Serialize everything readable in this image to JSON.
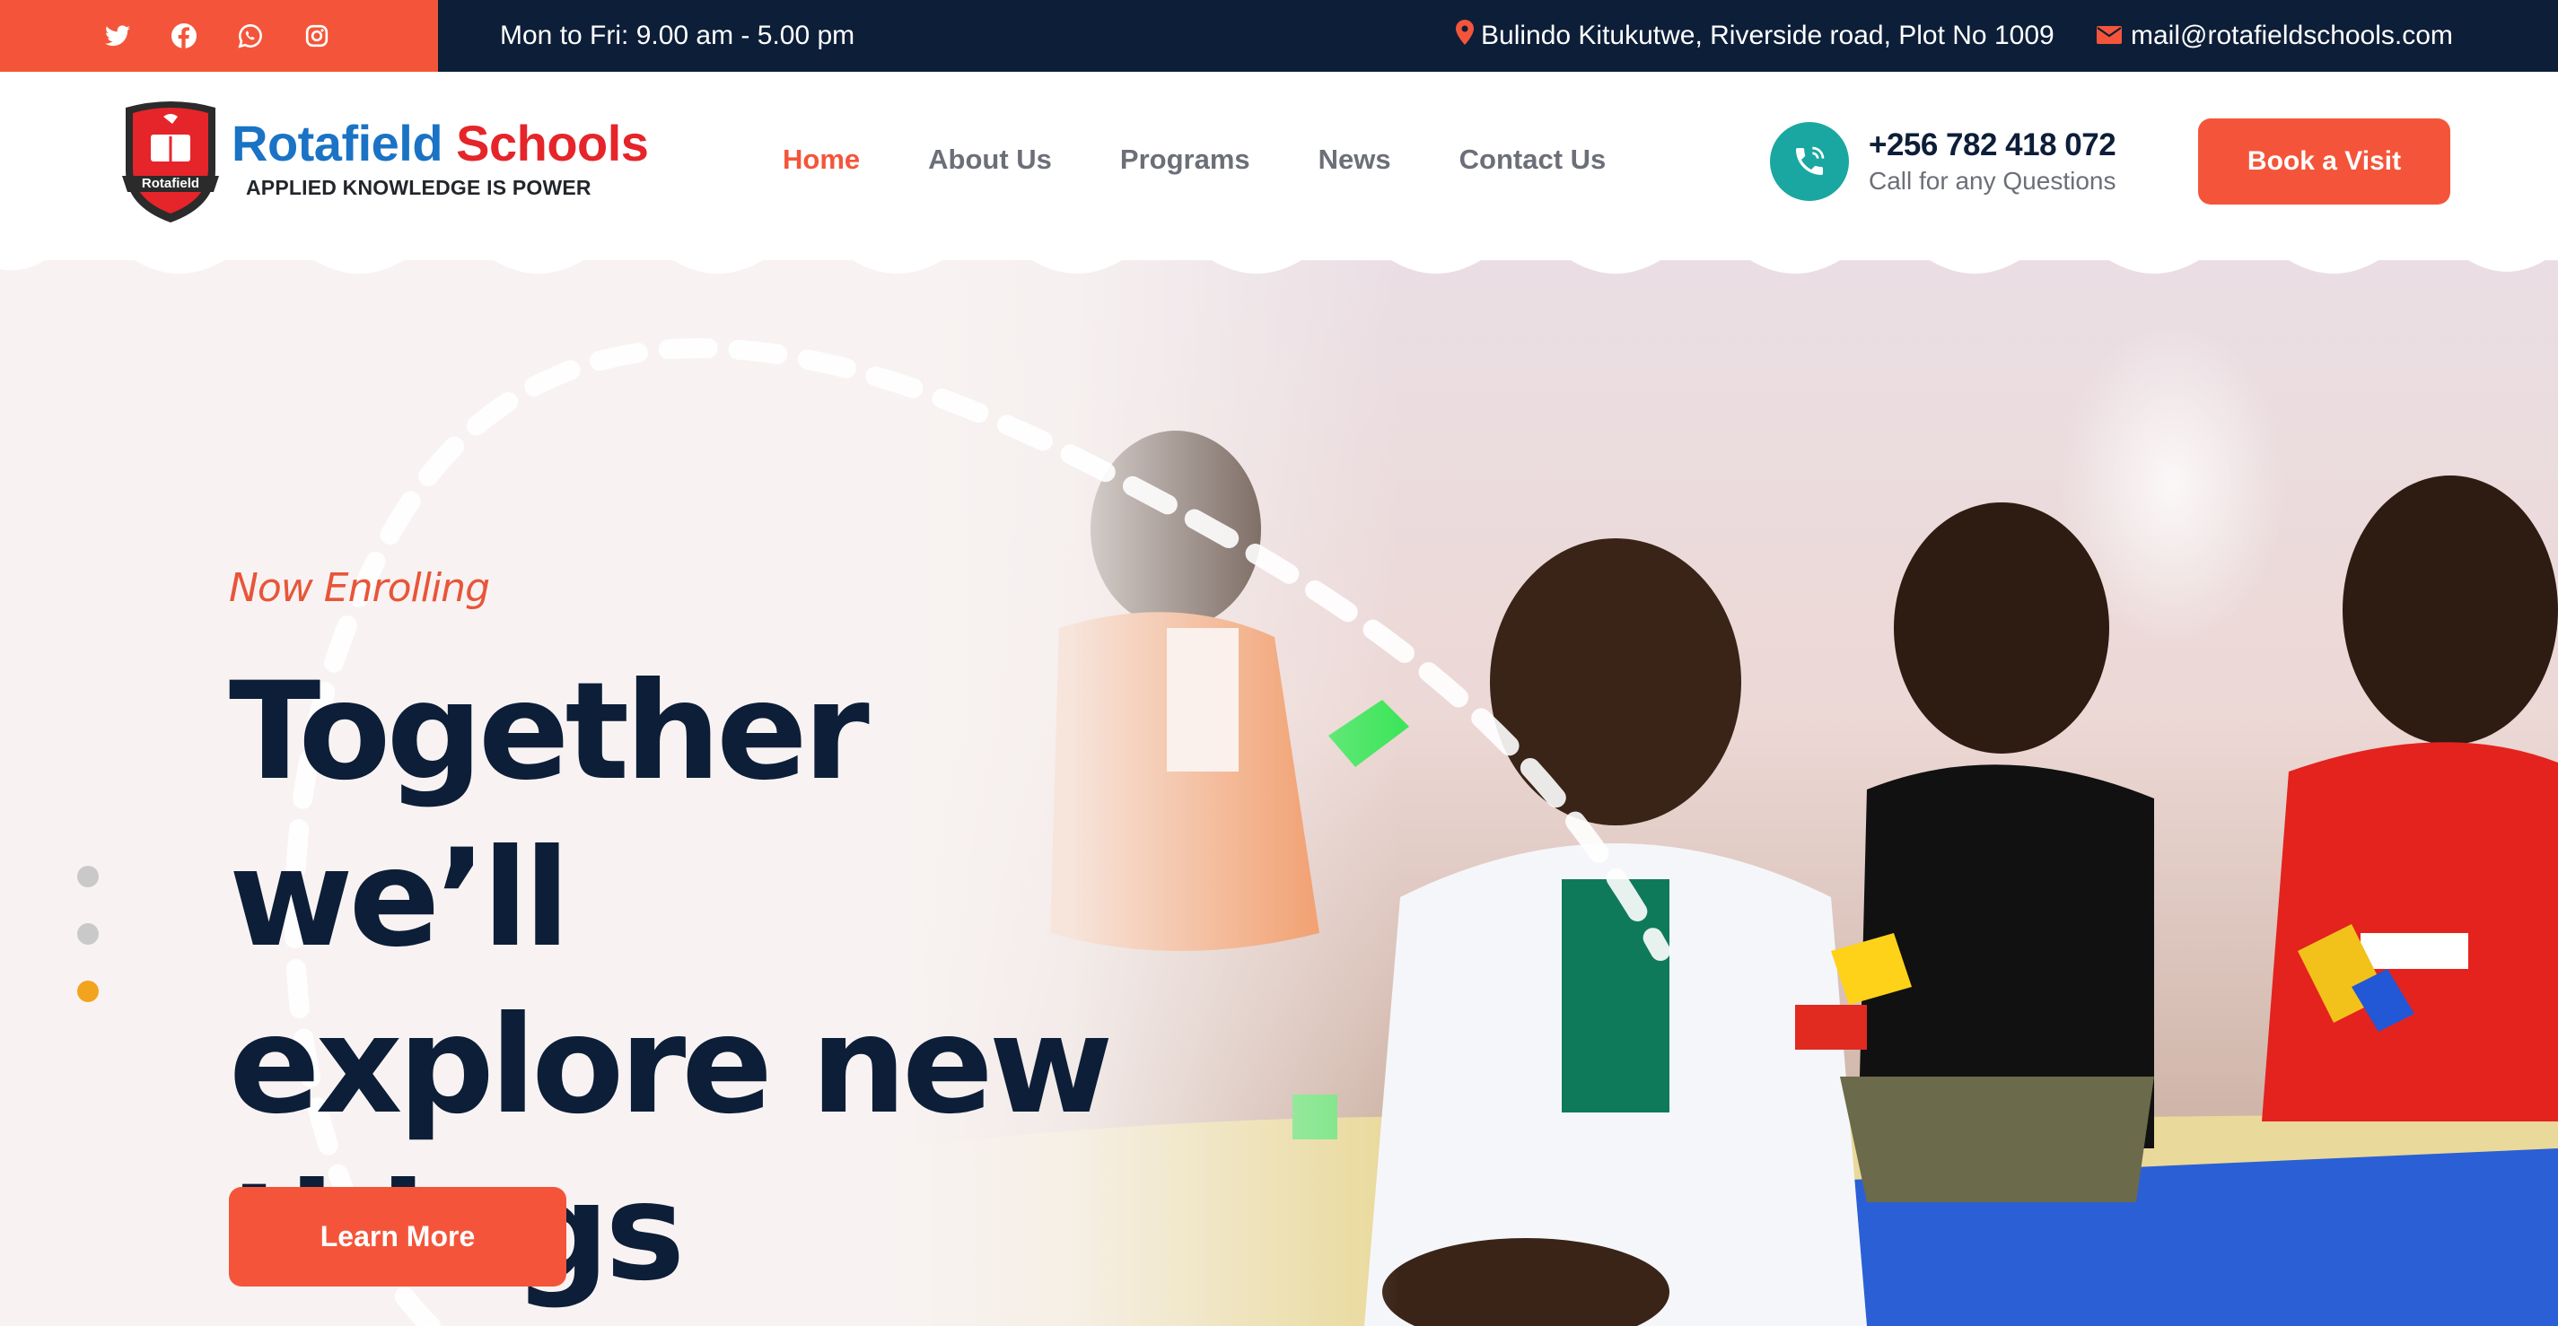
{
  "topbar": {
    "social_icons": [
      "twitter-icon",
      "facebook-icon",
      "whatsapp-icon",
      "instagram-icon"
    ],
    "hours": "Mon to Fri: 9.00 am - 5.00 pm",
    "address": "Bulindo Kitukutwe, Riverside road, Plot No 1009",
    "email": "mail@rotafieldschools.com"
  },
  "header": {
    "logo": {
      "name_part1": "Rotafield",
      "name_part2": "Schools",
      "tagline": "APPLIED KNOWLEDGE IS POWER",
      "crest_text": "Rotafield"
    },
    "nav": [
      {
        "label": "Home",
        "active": true
      },
      {
        "label": "About Us",
        "active": false
      },
      {
        "label": "Programs",
        "active": false
      },
      {
        "label": "News",
        "active": false
      },
      {
        "label": "Contact Us",
        "active": false
      }
    ],
    "phone": {
      "number": "+256 782 418 072",
      "caption": "Call for any Questions"
    },
    "cta_label": "Book a Visit"
  },
  "hero": {
    "eyebrow": "Now Enrolling",
    "headline_line1": "Together we’ll",
    "headline_line2": "explore new",
    "headline_line3": "things",
    "button_label": "Learn More",
    "slider_dots": 3,
    "active_dot": 3
  },
  "colors": {
    "accent": "#f4553a",
    "navy": "#0d1e38",
    "teal": "#1aa7a1",
    "brand_blue": "#1a73c4",
    "brand_red": "#e5252a",
    "dot_active": "#f2a41f"
  }
}
